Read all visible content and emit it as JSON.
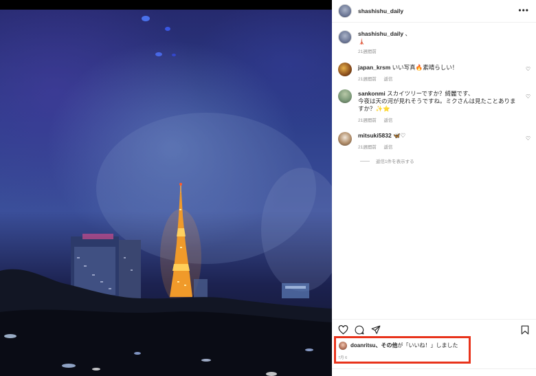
{
  "post": {
    "username": "shashishu_daily",
    "caption_suffix": "、",
    "caption_emoji": "🗼",
    "time": "21週間前"
  },
  "header": {
    "username": "shashishu_daily",
    "more_icon": "more-horizontal-icon"
  },
  "comments": [
    {
      "username": "japan_krsm",
      "text": "いい写真🔥素晴らしい！",
      "time": "21週間前",
      "reply": "返信"
    },
    {
      "username": "sankonmi",
      "text_line1": "スカイツリーですか？綺麗です、",
      "text_line2": "今夜は天の河が見れそうですね。ミクさんは見たことありま",
      "text_line3": "すか？✨⭐",
      "time": "21週間前",
      "reply": "返信"
    },
    {
      "username": "mitsuki5832",
      "text": "🦋♡",
      "time": "21週間前",
      "reply": "返信"
    }
  ],
  "view_replies": "返信1件を表示する",
  "likes": {
    "user": "doanritsu",
    "others": "、その他",
    "suffix": "が「いいね！」しました",
    "date": "7月 6"
  },
  "colors": {
    "highlight_border": "#e8331b",
    "secondary_text": "#8e8e8e"
  }
}
